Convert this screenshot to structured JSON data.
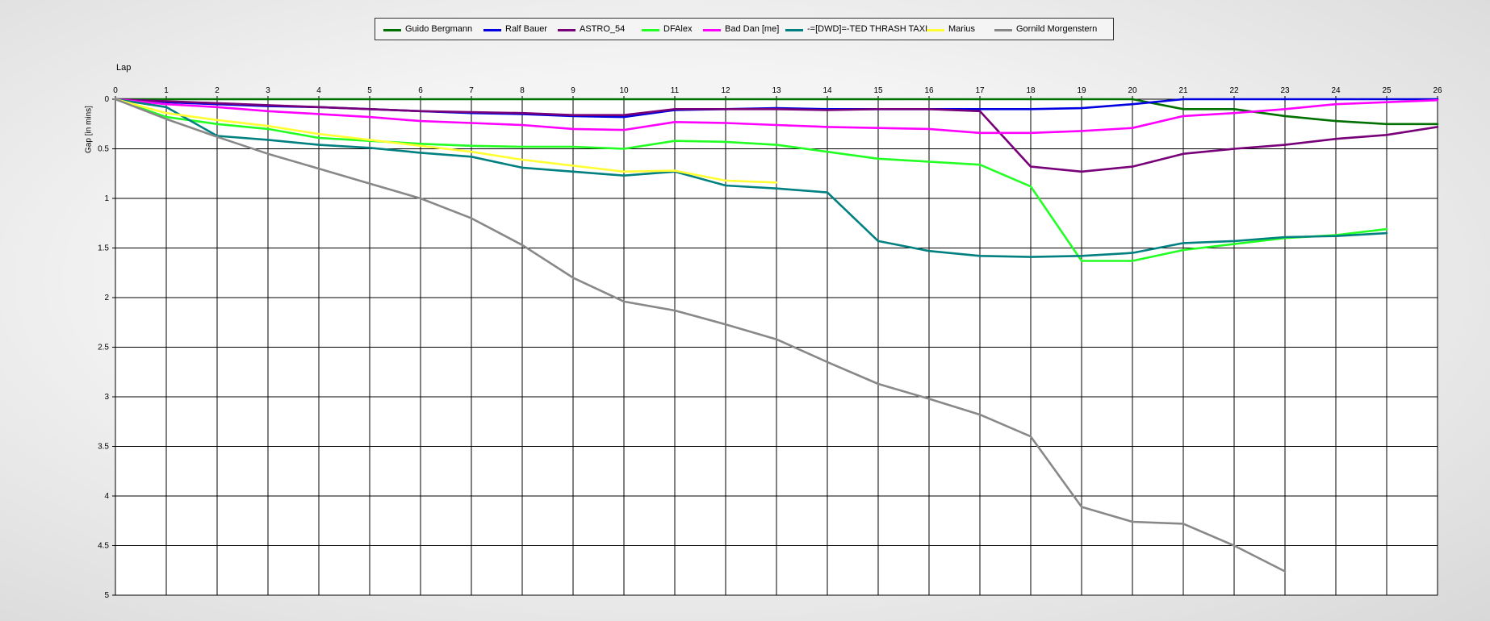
{
  "chart_data": {
    "type": "line",
    "title": "",
    "xlabel": "Lap",
    "ylabel": "Gap [in mins]",
    "xlim": [
      0,
      26
    ],
    "ylim": [
      0,
      5
    ],
    "y_inverted": true,
    "grid": true,
    "legend_position": "top-center",
    "x_ticks": [
      "0",
      "1",
      "2",
      "3",
      "4",
      "5",
      "6",
      "7",
      "8",
      "9",
      "10",
      "11",
      "12",
      "13",
      "14",
      "15",
      "16",
      "17",
      "18",
      "19",
      "20",
      "21",
      "22",
      "23",
      "24",
      "25",
      "26"
    ],
    "y_ticks": [
      "0",
      "0.5",
      "1",
      "1.5",
      "2",
      "2.5",
      "3",
      "3.5",
      "4",
      "4.5",
      "5"
    ],
    "series": [
      {
        "name": "Guido Bergmann",
        "color": "#007000",
        "x": [
          0,
          1,
          2,
          3,
          4,
          5,
          6,
          7,
          8,
          9,
          10,
          11,
          12,
          13,
          14,
          15,
          16,
          17,
          18,
          19,
          20,
          21,
          22,
          23,
          24,
          25,
          26
        ],
        "y": [
          0,
          0,
          0,
          0,
          0,
          0,
          0,
          0,
          0,
          0,
          0,
          0,
          0,
          0,
          0,
          0,
          0,
          0,
          0,
          0,
          0,
          0.1,
          0.1,
          0.17,
          0.22,
          0.25,
          0.25
        ]
      },
      {
        "name": "Ralf Bauer",
        "color": "#0000e0",
        "x": [
          0,
          1,
          2,
          3,
          4,
          5,
          6,
          7,
          8,
          9,
          10,
          11,
          12,
          13,
          14,
          15,
          16,
          17,
          18,
          19,
          20,
          21,
          22,
          23,
          24,
          25,
          26
        ],
        "y": [
          0,
          0.03,
          0.05,
          0.07,
          0.08,
          0.1,
          0.12,
          0.14,
          0.15,
          0.17,
          0.18,
          0.11,
          0.1,
          0.09,
          0.1,
          0.1,
          0.1,
          0.1,
          0.1,
          0.09,
          0.05,
          0,
          0,
          0,
          0,
          0,
          0
        ]
      },
      {
        "name": "ASTRO_54",
        "color": "#780078",
        "x": [
          0,
          1,
          2,
          3,
          4,
          5,
          6,
          7,
          8,
          9,
          10,
          11,
          12,
          13,
          14,
          15,
          16,
          17,
          18,
          19,
          20,
          21,
          22,
          23,
          24,
          25,
          26
        ],
        "y": [
          0,
          0.02,
          0.04,
          0.06,
          0.08,
          0.1,
          0.12,
          0.13,
          0.14,
          0.16,
          0.16,
          0.1,
          0.1,
          0.1,
          0.11,
          0.1,
          0.1,
          0.12,
          0.68,
          0.73,
          0.68,
          0.55,
          0.5,
          0.46,
          0.4,
          0.36,
          0.28
        ]
      },
      {
        "name": "DFAlex",
        "color": "#22ff22",
        "x": [
          0,
          1,
          2,
          3,
          4,
          5,
          6,
          7,
          8,
          9,
          10,
          11,
          12,
          13,
          14,
          15,
          16,
          17,
          18,
          19,
          20,
          21,
          22,
          23,
          24,
          25
        ],
        "y": [
          0,
          0.18,
          0.25,
          0.3,
          0.39,
          0.42,
          0.45,
          0.47,
          0.48,
          0.48,
          0.5,
          0.42,
          0.43,
          0.46,
          0.53,
          0.6,
          0.63,
          0.66,
          0.88,
          1.63,
          1.63,
          1.52,
          1.46,
          1.4,
          1.37,
          1.31
        ]
      },
      {
        "name": "Bad Dan [me]",
        "color": "#ff00ff",
        "x": [
          0,
          1,
          2,
          3,
          4,
          5,
          6,
          7,
          8,
          9,
          10,
          11,
          12,
          13,
          14,
          15,
          16,
          17,
          18,
          19,
          20,
          21,
          22,
          23,
          24,
          25,
          26
        ],
        "y": [
          0,
          0.05,
          0.08,
          0.12,
          0.15,
          0.18,
          0.22,
          0.24,
          0.26,
          0.3,
          0.31,
          0.23,
          0.24,
          0.26,
          0.28,
          0.29,
          0.3,
          0.34,
          0.34,
          0.32,
          0.29,
          0.17,
          0.14,
          0.1,
          0.05,
          0.03,
          0.01
        ]
      },
      {
        "name": "-=[DWD]=-TED THRASH TAXI",
        "color": "#008080",
        "x": [
          0,
          1,
          2,
          3,
          4,
          5,
          6,
          7,
          8,
          9,
          10,
          11,
          12,
          13,
          14,
          15,
          16,
          17,
          18,
          19,
          20,
          21,
          22,
          23,
          24,
          25
        ],
        "y": [
          0,
          0.08,
          0.37,
          0.41,
          0.46,
          0.49,
          0.54,
          0.58,
          0.69,
          0.73,
          0.77,
          0.73,
          0.87,
          0.9,
          0.94,
          1.43,
          1.53,
          1.58,
          1.59,
          1.58,
          1.55,
          1.45,
          1.43,
          1.39,
          1.38,
          1.35
        ]
      },
      {
        "name": "Marius",
        "color": "#ffff33",
        "x": [
          0,
          1,
          2,
          3,
          4,
          5,
          6,
          7,
          8,
          9,
          10,
          11,
          12,
          13
        ],
        "y": [
          0,
          0.14,
          0.21,
          0.27,
          0.35,
          0.41,
          0.47,
          0.53,
          0.61,
          0.67,
          0.73,
          0.72,
          0.82,
          0.84
        ]
      },
      {
        "name": "Gornild Morgenstern",
        "color": "#888888",
        "x": [
          0,
          1,
          2,
          3,
          4,
          5,
          6,
          7,
          8,
          9,
          10,
          11,
          12,
          13,
          14,
          15,
          16,
          17,
          18,
          19,
          20,
          21,
          22,
          23
        ],
        "y": [
          0,
          0.2,
          0.38,
          0.55,
          0.7,
          0.85,
          1.0,
          1.2,
          1.47,
          1.8,
          2.04,
          2.13,
          2.27,
          2.42,
          2.65,
          2.87,
          3.02,
          3.18,
          3.4,
          4.11,
          4.26,
          4.28,
          4.5,
          4.76
        ]
      }
    ]
  }
}
